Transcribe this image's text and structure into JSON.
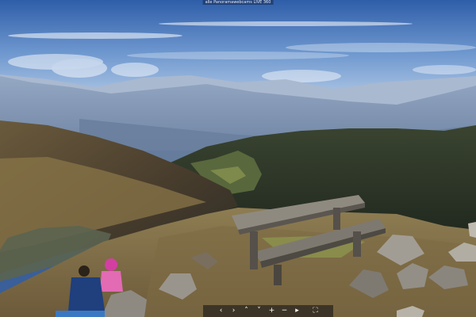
{
  "photo": {
    "subject": "mountain-view-with-bench-and-hikers",
    "credit_text": "alle Panoramawebcams LIVE 360"
  },
  "viewer": {
    "controls": [
      {
        "icon": "arrow-left-icon",
        "glyph": "‹"
      },
      {
        "icon": "arrow-right-icon",
        "glyph": "›"
      },
      {
        "icon": "arrow-up-icon",
        "glyph": "˄"
      },
      {
        "icon": "arrow-down-icon",
        "glyph": "˅"
      },
      {
        "icon": "zoom-in-icon",
        "glyph": "+"
      },
      {
        "icon": "zoom-out-icon",
        "glyph": "−"
      },
      {
        "icon": "play-icon",
        "glyph": "▸"
      },
      {
        "icon": "fullscreen-icon",
        "glyph": "⛶"
      }
    ]
  },
  "colors": {
    "sky_top": "#3a66b2",
    "sky_bottom": "#c9dbee",
    "mountain_far": "#7f95b2",
    "forest": "#2f3a2a",
    "grass": "#9c8a55"
  }
}
